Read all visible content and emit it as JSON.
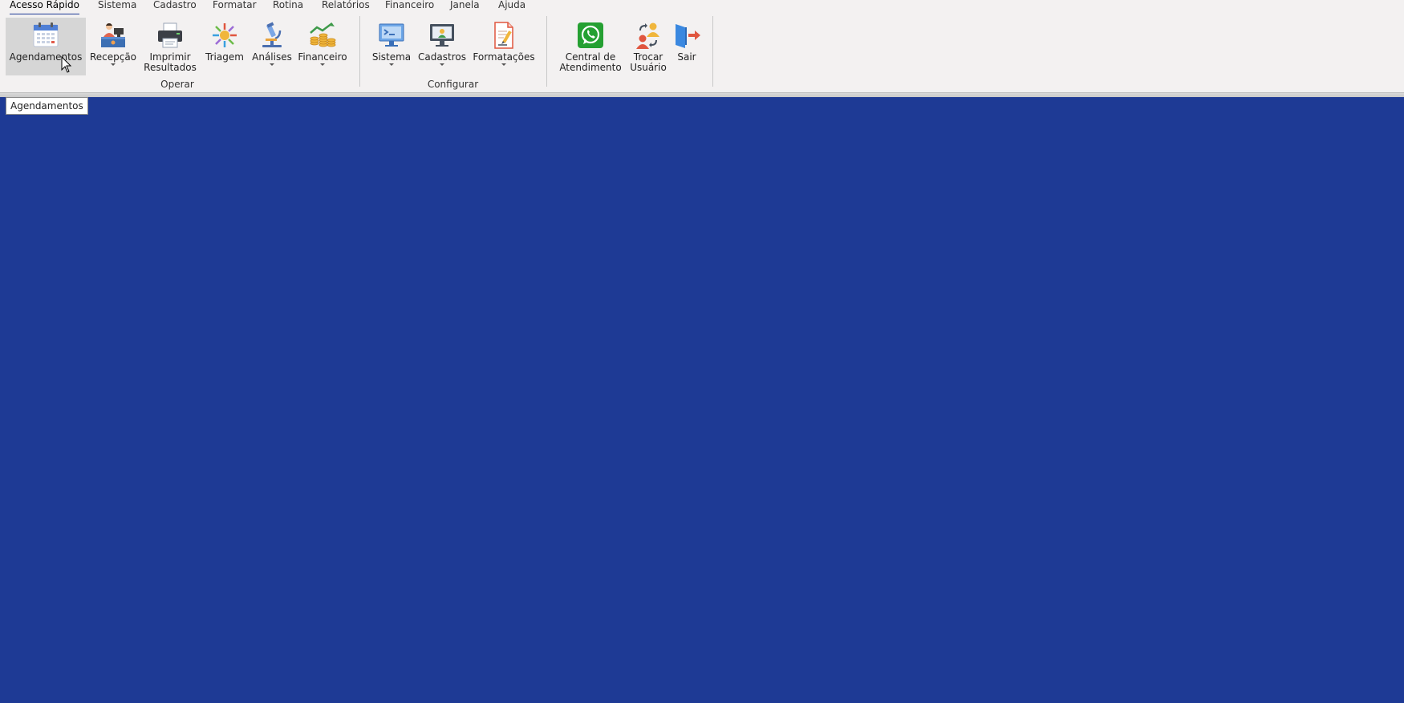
{
  "tabs": [
    {
      "label": "Acesso Rápido",
      "active": true
    },
    {
      "label": "Sistema"
    },
    {
      "label": "Cadastro"
    },
    {
      "label": "Formatar"
    },
    {
      "label": "Rotina"
    },
    {
      "label": "Relatórios"
    },
    {
      "label": "Financeiro"
    },
    {
      "label": "Janela"
    },
    {
      "label": "Ajuda"
    }
  ],
  "ribbon": {
    "groups": {
      "operar": "Operar",
      "configurar": "Configurar"
    },
    "buttons": {
      "agendamentos": {
        "line1": "Agendamentos",
        "icon": "calendar-icon"
      },
      "recepcao": {
        "line1": "Recepção",
        "icon": "reception-desk-icon",
        "dropdown": true
      },
      "imprimir": {
        "line1": "Imprimir",
        "line2": "Resultados",
        "icon": "printer-icon"
      },
      "triagem": {
        "line1": "Triagem",
        "icon": "triage-arrows-icon"
      },
      "analises": {
        "line1": "Análises",
        "icon": "microscope-icon",
        "dropdown": true
      },
      "financeiro": {
        "line1": "Financeiro",
        "icon": "coins-chart-icon",
        "dropdown": true
      },
      "sistema": {
        "line1": "Sistema",
        "icon": "monitor-icon",
        "dropdown": true
      },
      "cadastros": {
        "line1": "Cadastros",
        "icon": "monitor-register-icon",
        "dropdown": true
      },
      "formatacoes": {
        "line1": "Formatações",
        "icon": "document-edit-icon",
        "dropdown": true
      },
      "central": {
        "line1": "Central de",
        "line2": "Atendimento",
        "icon": "whatsapp-icon"
      },
      "trocar": {
        "line1": "Trocar",
        "line2": "Usuário",
        "icon": "switch-user-icon"
      },
      "sair": {
        "line1": "Sair",
        "icon": "exit-door-icon"
      }
    }
  },
  "tooltip": "Agendamentos",
  "colors": {
    "workspace": "#1e3a95",
    "ribbon": "#f3f1f1",
    "whatsapp": "#25a032"
  }
}
